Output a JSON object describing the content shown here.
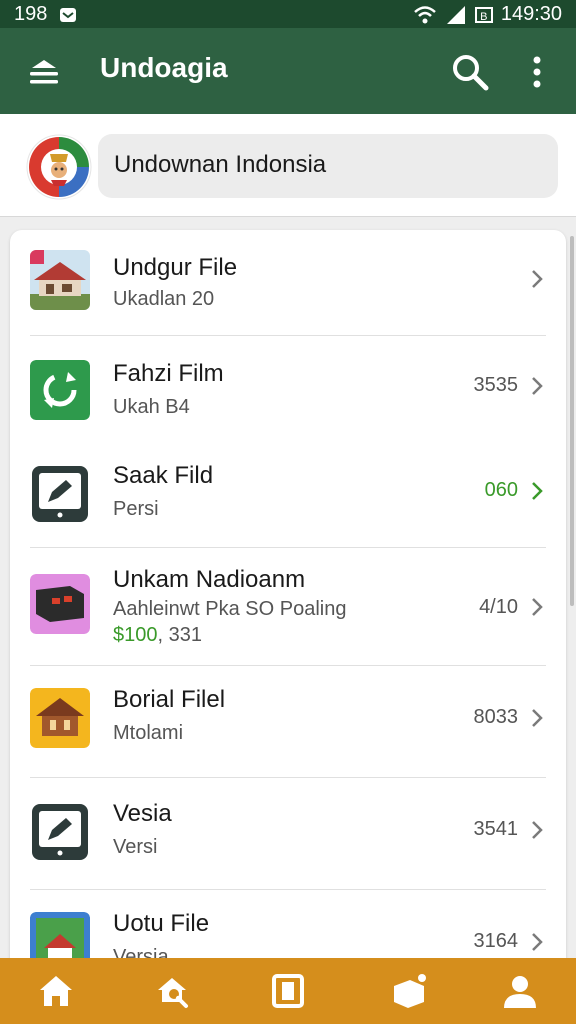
{
  "status": {
    "time_left": "198",
    "time_right": "149:30",
    "battery_label": "B"
  },
  "appbar": {
    "title": "Undoagia"
  },
  "header": {
    "field_text": "Undownan Indonsia"
  },
  "list": [
    {
      "title": "Undgur File",
      "subtitle": "Ukadlan 20",
      "value": "",
      "value_color": "#555555"
    },
    {
      "title": "Fahzi Film",
      "subtitle": "Ukah B4",
      "value": "3535",
      "value_color": "#555555"
    },
    {
      "title": "Saak Fild",
      "subtitle": "Persi",
      "value": "060",
      "value_color": "#3a9a2a"
    },
    {
      "title": "Unkam Nadioanm",
      "subtitle": "Aahleinwt Pka SO Poaling",
      "extra_price": "$100",
      "extra_rest": ", 331",
      "value": "4/10",
      "value_color": "#555555"
    },
    {
      "title": "Borial Filel",
      "subtitle": "Mtolami",
      "value": "8033",
      "value_color": "#555555"
    },
    {
      "title": "Vesia",
      "subtitle": "Versi",
      "value": "3541",
      "value_color": "#555555"
    },
    {
      "title": "Uotu File",
      "subtitle": "Versia",
      "value": "3164",
      "value_color": "#555555"
    }
  ],
  "icons": {
    "status": [
      "mail-icon",
      "wifi-icon",
      "signal-icon",
      "battery-icon"
    ],
    "appbar": [
      "menu-icon",
      "search-icon",
      "more-vert-icon"
    ],
    "nav": [
      "home-icon",
      "search-icon",
      "book-icon",
      "package-icon",
      "profile-icon"
    ]
  },
  "colors": {
    "appbar": "#2e6142",
    "statusbar": "#1d4a2e",
    "bottomnav": "#d58e1c",
    "accent_green": "#3a9a2a"
  }
}
